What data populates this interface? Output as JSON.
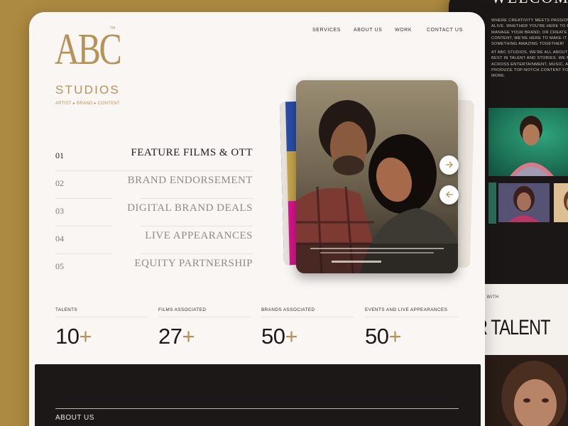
{
  "brand": {
    "logo_text": "ABC",
    "logo_tm": "TM",
    "logo_sub": "STUDIOS",
    "tagline": "ARTIST ▸ BRAND ▸ CONTENT",
    "gold": "#b69258"
  },
  "nav": {
    "items": [
      "SERVICES",
      "ABOUT US",
      "WORK",
      "CONTACT US"
    ]
  },
  "services": [
    {
      "num": "01",
      "label": "FEATURE FILMS & OTT",
      "active": true
    },
    {
      "num": "02",
      "label": "BRAND ENDORSEMENT",
      "active": false
    },
    {
      "num": "03",
      "label": "DIGITAL BRAND DEALS",
      "active": false
    },
    {
      "num": "04",
      "label": "LIVE APPEARANCES",
      "active": false
    },
    {
      "num": "05",
      "label": "EQUITY PARTNERSHIP",
      "active": false
    }
  ],
  "carousel": {
    "next_icon": "arrow-right-icon",
    "prev_icon": "arrow-left-icon"
  },
  "stats": [
    {
      "caption": "TALENTS",
      "value": "10",
      "suffix": "+"
    },
    {
      "caption": "FILMS ASSOCIATED",
      "value": "27",
      "suffix": "+"
    },
    {
      "caption": "BRANDS ASSOCIATED",
      "value": "50",
      "suffix": "+"
    },
    {
      "caption": "EVENTS AND LIVE APPEARANCES",
      "value": "50",
      "suffix": "+"
    }
  ],
  "footer": {
    "section_label": "ABOUT US"
  },
  "back_page": {
    "welcome": "WELCOME",
    "para1": "WHERE CREATIVITY MEETS PASSION, AN\nALIVE. WHETHER YOU'RE HERE TO FIND T\nMANAGE YOUR BRAND, OR CREATE UNFO\nCONTENT, WE'RE HERE TO MAKE IT HAPP\nSOMETHING AMAZING TOGETHER!",
    "para2": "AT ABC STUDIOS, WE'RE ALL ABOUT BRI\nBEST IN TALENT AND STORIES. WE MANA\nACROSS ENTERTAINMENT, MUSIC, AND\nPRODUCE TOP-NOTCH CONTENT FOR A\nMORE.",
    "work_with": "RK WITH",
    "talent_heading": "R TALENT"
  }
}
